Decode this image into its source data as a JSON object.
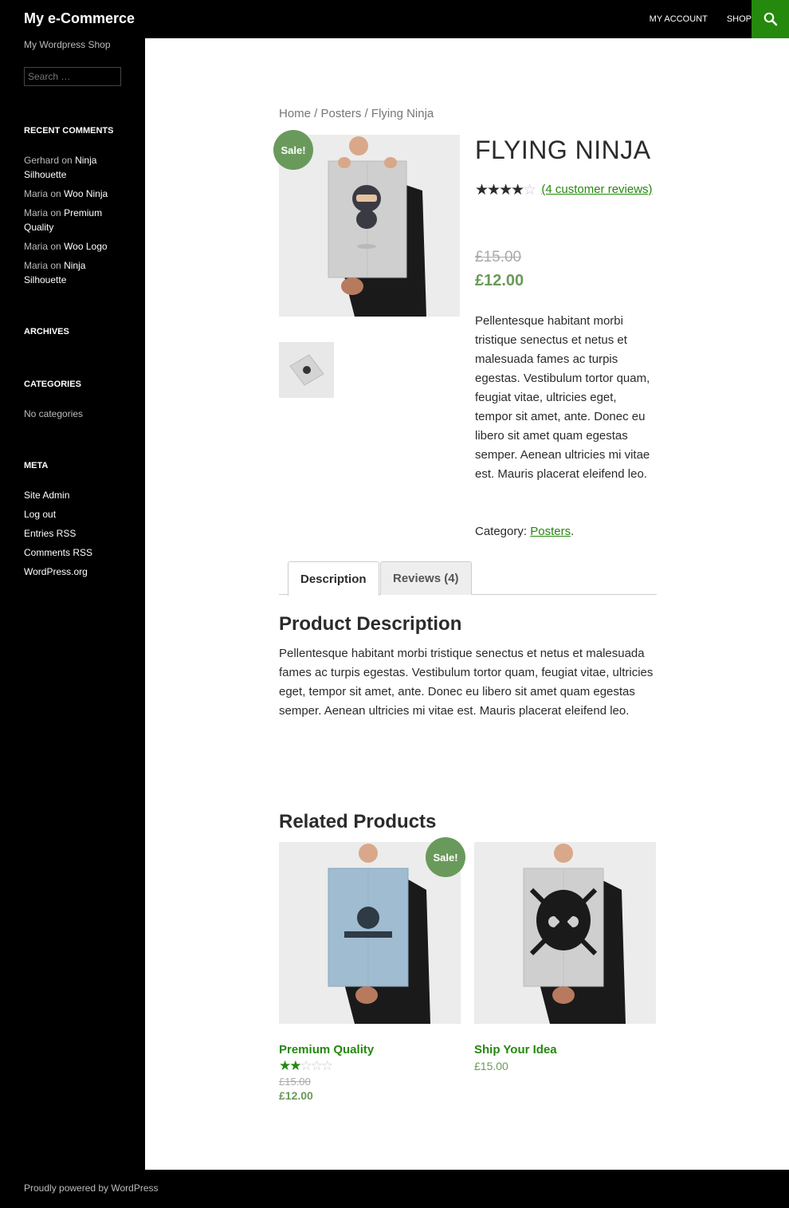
{
  "header": {
    "site_title": "My e-Commerce",
    "nav": [
      "MY ACCOUNT",
      "SHOP"
    ],
    "search_icon": "search-icon",
    "accent": "#24890d"
  },
  "sidebar": {
    "tagline": "My Wordpress Shop",
    "search_placeholder": "Search …",
    "recent_comments": {
      "title": "RECENT COMMENTS",
      "items": [
        {
          "author": "Gerhard",
          "on": "on",
          "post": "Ninja Silhouette"
        },
        {
          "author": "Maria",
          "on": "on",
          "post": "Woo Ninja"
        },
        {
          "author": "Maria",
          "on": "on",
          "post": "Premium Quality"
        },
        {
          "author": "Maria",
          "on": "on",
          "post": "Woo Logo"
        },
        {
          "author": "Maria",
          "on": "on",
          "post": "Ninja Silhouette"
        }
      ]
    },
    "archives": {
      "title": "ARCHIVES"
    },
    "categories": {
      "title": "CATEGORIES",
      "empty": "No categories"
    },
    "meta": {
      "title": "META",
      "items": [
        "Site Admin",
        "Log out",
        "Entries RSS",
        "Comments RSS",
        "WordPress.org"
      ]
    }
  },
  "breadcrumb": {
    "home": "Home",
    "sep": " / ",
    "category": "Posters",
    "current": "Flying Ninja"
  },
  "product": {
    "sale_badge": "Sale!",
    "title": "FLYING NINJA",
    "rating": 4,
    "rating_max": 5,
    "reviews_link": "(4 customer reviews)",
    "price_old": "£15.00",
    "price_new": "£12.00",
    "short_description": "Pellentesque habitant morbi tristique senectus et netus et malesuada fames ac turpis egestas. Vestibulum tortor quam, feugiat vitae, ultricies eget, tempor sit amet, ante. Donec eu libero sit amet quam egestas semper. Aenean ultricies mi vitae est. Mauris placerat eleifend leo.",
    "category_label": "Category:",
    "category": "Posters",
    "category_end": ".",
    "sale_color": "#6a9a5b"
  },
  "tabs": {
    "description": "Description",
    "reviews": "Reviews (4)"
  },
  "description": {
    "heading": "Product Description",
    "body": "Pellentesque habitant morbi tristique senectus et netus et malesuada fames ac turpis egestas. Vestibulum tortor quam, feugiat vitae, ultricies eget, tempor sit amet, ante. Donec eu libero sit amet quam egestas semper. Aenean ultricies mi vitae est. Mauris placerat eleifend leo."
  },
  "related": {
    "heading": "Related Products",
    "products": [
      {
        "name": "Premium Quality",
        "sale_badge": "Sale!",
        "rating": 2,
        "rating_max": 5,
        "price_old": "£15.00",
        "price_new": "£12.00"
      },
      {
        "name": "Ship Your Idea",
        "price": "£15.00"
      }
    ]
  },
  "footer": {
    "credit": "Proudly powered by WordPress"
  }
}
